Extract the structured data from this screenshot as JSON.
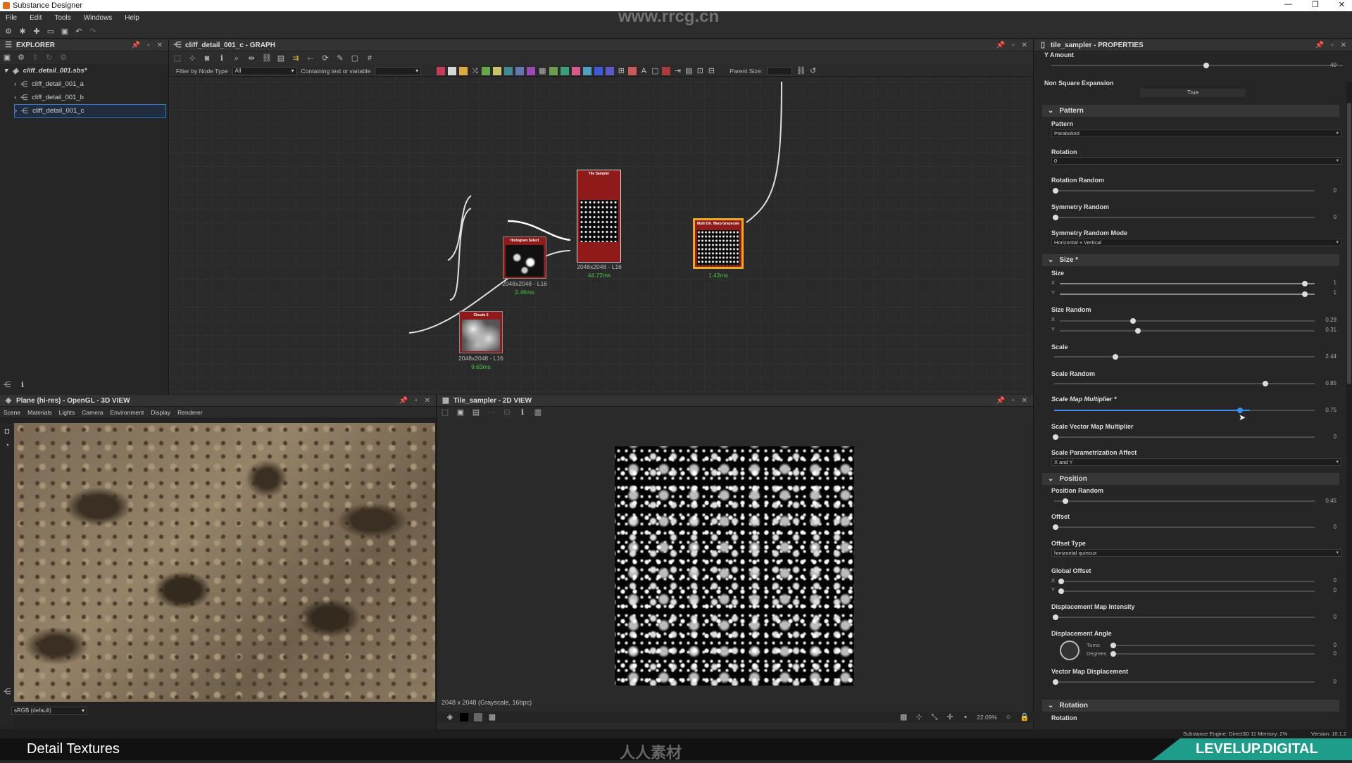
{
  "titlebar": {
    "title": "Substance Designer"
  },
  "menu": [
    "File",
    "Edit",
    "Tools",
    "Windows",
    "Help"
  ],
  "explorer": {
    "title": "EXPLORER",
    "package": "cliff_detail_001.sbs*",
    "items": [
      "cliff_detail_001_a",
      "cliff_detail_001_b",
      "cliff_detail_001_c"
    ],
    "selected_index": 2
  },
  "graph": {
    "title": "cliff_detail_001_c - GRAPH",
    "filter_label": "Filter by Node Type",
    "filter_value": "All",
    "contain_label": "Containing text or variable",
    "parent_size_label": "Parent Size:",
    "nodes": [
      {
        "title": "Histogram Select",
        "res": "2048x2048 - L16",
        "time": "2.46ms"
      },
      {
        "title": "Tile Sampler",
        "res": "2048x2048 - L16",
        "time": "44.72ms"
      },
      {
        "title": "Multi Dir. Warp Grayscale",
        "res": "",
        "time": "1.42ms"
      },
      {
        "title": "Clouds 2",
        "res": "2048x2048 - L16",
        "time": "9.63ms"
      }
    ]
  },
  "view3d": {
    "title": "Plane (hi-res) - OpenGL - 3D VIEW",
    "menu": [
      "Scene",
      "Materials",
      "Lights",
      "Camera",
      "Environment",
      "Display",
      "Renderer"
    ],
    "colorspace": "sRGB (default)"
  },
  "view2d": {
    "title": "Tile_sampler - 2D VIEW",
    "info": "2048 x 2048 (Grayscale, 16bpc)",
    "zoom": "22.09%"
  },
  "properties": {
    "title": "tile_sampler - PROPERTIES",
    "y_amount_label": "Y Amount",
    "y_amount_value": "40",
    "non_square_label": "Non Square Expansion",
    "non_square_value": "True",
    "sections": {
      "pattern": "Pattern",
      "size": "Size *",
      "position": "Position",
      "rotation": "Rotation"
    },
    "pattern_label": "Pattern",
    "pattern_value": "Paraboloid",
    "rotation_label": "Rotation",
    "rotation_value": "0",
    "rotation_random_label": "Rotation Random",
    "rotation_random_value": "0",
    "symmetry_random_label": "Symmetry Random",
    "symmetry_random_value": "0",
    "symmetry_mode_label": "Symmetry Random Mode",
    "symmetry_mode_value": "Horizontal + Vertical",
    "size_label": "Size",
    "size_x": "1",
    "size_y": "1",
    "size_random_label": "Size Random",
    "size_random_x": "0.29",
    "size_random_y": "0.31",
    "scale_label": "Scale",
    "scale_value": "2.44",
    "scale_random_label": "Scale Random",
    "scale_random_value": "0.85",
    "scale_map_label": "Scale Map Multiplier *",
    "scale_map_value": "0.75",
    "scale_vector_label": "Scale Vector Map Multiplier",
    "scale_vector_value": "0",
    "scale_param_label": "Scale Parametrization Affect",
    "scale_param_value": "X and Y",
    "position_random_label": "Position Random",
    "position_random_value": "0.45",
    "offset_label": "Offset",
    "offset_value": "0",
    "offset_type_label": "Offset Type",
    "offset_type_value": "horizontal quincux",
    "global_offset_label": "Global Offset",
    "global_offset_x": "0",
    "global_offset_y": "0",
    "disp_intensity_label": "Displacement Map Intensity",
    "disp_intensity_value": "0",
    "disp_angle_label": "Displacement Angle",
    "turns_label": "Turns",
    "degrees_label": "Degrees",
    "disp_angle_turns": "0",
    "disp_angle_degrees": "0",
    "vector_disp_label": "Vector Map Displacement",
    "vector_disp_value": "0",
    "rotation2_label": "Rotation",
    "axis_x": "X",
    "axis_y": "Y"
  },
  "status": {
    "engine": "Substance Engine: Direct3D 11  Memory: 2%",
    "version": "Version: 10.1.2"
  },
  "bottom": {
    "left": "Detail Textures",
    "center": "人人素材",
    "right": "LEVELUP.DIGITAL",
    "watermark_site": "www.rrcg.cn"
  }
}
